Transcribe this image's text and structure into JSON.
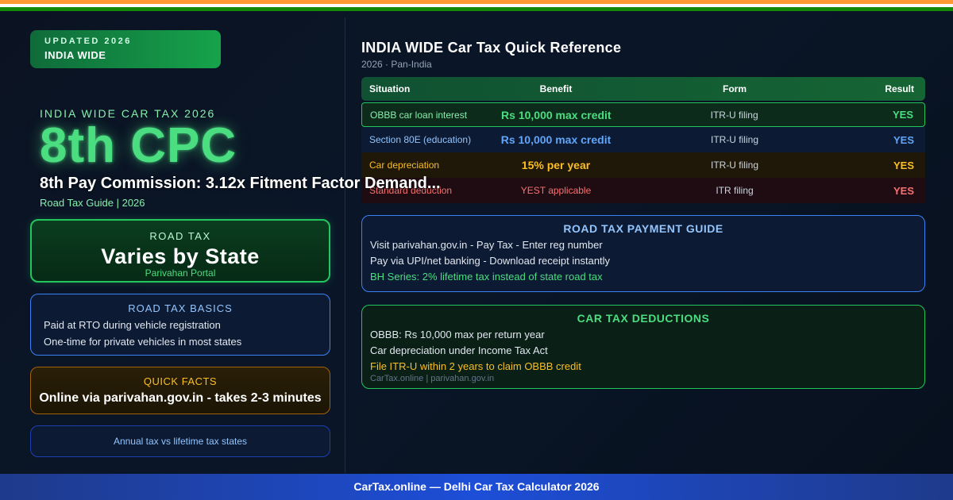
{
  "badge": {
    "line1": "UPDATED 2026",
    "line2": "INDIA WIDE"
  },
  "hero": {
    "eyebrow": "INDIA WIDE CAR TAX 2026",
    "title": "8th CPC",
    "headline": "8th Pay Commission: 3.12x Fitment Factor Demand...",
    "subline": "Road Tax Guide | 2026"
  },
  "road_tax_card": {
    "label": "ROAD TAX",
    "value": "Varies by State",
    "sub": "Parivahan Portal"
  },
  "basics_card": {
    "label": "ROAD TAX BASICS",
    "items": [
      "Paid at RTO during vehicle registration",
      "One-time for private vehicles in most states"
    ]
  },
  "facts_card": {
    "label": "QUICK FACTS",
    "value": "Online via parivahan.gov.in - takes 2-3 minutes"
  },
  "annual_card": {
    "text": "Annual tax vs lifetime tax states"
  },
  "reference": {
    "title": "INDIA WIDE Car Tax Quick Reference",
    "subtitle": "2026 · Pan-India",
    "headers": [
      "Situation",
      "Benefit",
      "Form",
      "Result"
    ],
    "rows": [
      {
        "situation": "OBBB car loan interest",
        "benefit": "Rs 10,000 max credit",
        "form": "ITR-U filing",
        "result": "YES"
      },
      {
        "situation": "Section 80E (education)",
        "benefit": "Rs 10,000 max credit",
        "form": "ITR-U filing",
        "result": "YES"
      },
      {
        "situation": "Car depreciation",
        "benefit": "15% per year",
        "form": "ITR-U filing",
        "result": "YES"
      },
      {
        "situation": "Standard deduction",
        "benefit": "YEST applicable",
        "form": "ITR filing",
        "result": "YES"
      }
    ]
  },
  "payment_guide": {
    "title": "ROAD TAX PAYMENT GUIDE",
    "lines": [
      "Visit parivahan.gov.in - Pay Tax - Enter reg number",
      "Pay via UPI/net banking - Download receipt instantly",
      "BH Series: 2% lifetime tax instead of state road tax"
    ]
  },
  "deductions": {
    "title": "CAR TAX DEDUCTIONS",
    "lines": [
      "OBBB: Rs 10,000 max per return year",
      "Car depreciation under Income Tax Act",
      "File ITR-U within 2 years to claim OBBB credit"
    ],
    "foot": "CarTax.online | parivahan.gov.in"
  },
  "footer": {
    "text": "CarTax.online — Delhi Car Tax Calculator 2026"
  },
  "colors": {
    "saffron": "#ff9933",
    "white": "#ffffff",
    "green": "#138808",
    "accent": "#4ade80",
    "footer": "#1d4ed8"
  }
}
